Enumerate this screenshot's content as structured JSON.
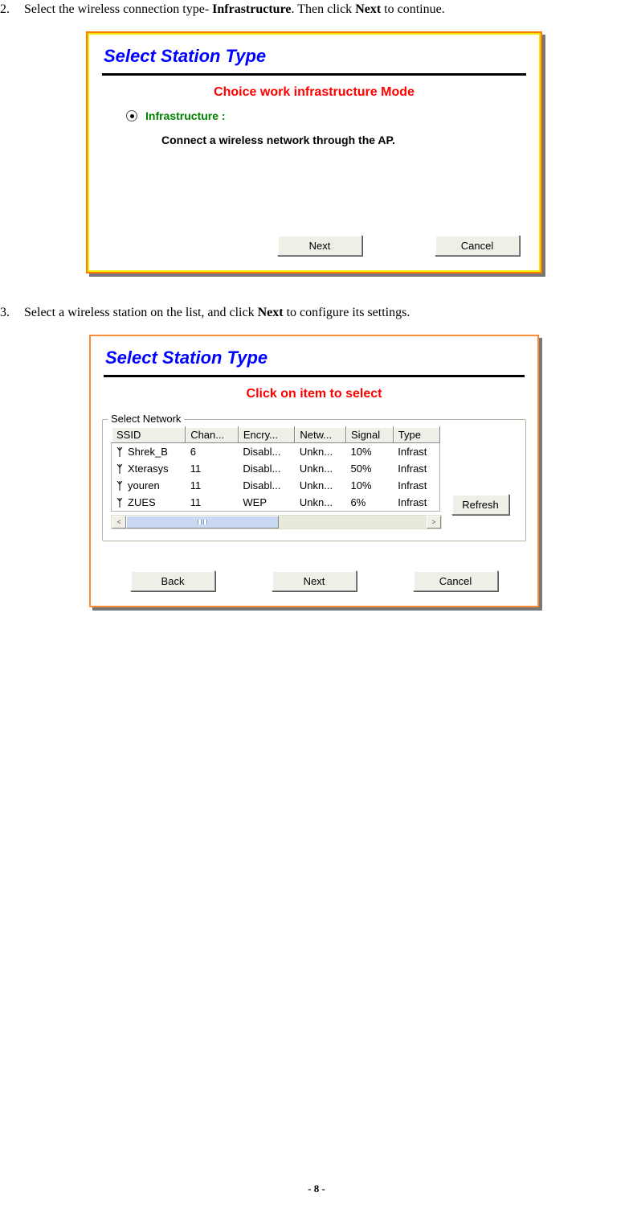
{
  "step2": {
    "num": "2.",
    "text_a": "Select the wireless connection type- ",
    "bold1": "Infrastructure",
    "text_b": ". Then click ",
    "bold2": "Next",
    "text_c": " to continue."
  },
  "win1": {
    "title": "Select Station Type",
    "subtitle": "Choice work infrastructure  Mode",
    "radio_label": "Infrastructure :",
    "radio_desc": "Connect  a wireless  network  through  the AP.",
    "btn_next": "Next",
    "btn_cancel": "Cancel"
  },
  "step3": {
    "num": "3.",
    "text_a": "Select a wireless station on the list, and click ",
    "bold1": "Next",
    "text_b": " to configure its settings."
  },
  "win2": {
    "title": "Select Station Type",
    "subtitle": "Click on item to select",
    "legend": "Select Network",
    "headers": {
      "ssid": "SSID",
      "chan": "Chan...",
      "encry": "Encry...",
      "netw": "Netw...",
      "signal": "Signal",
      "type": "Type"
    },
    "rows": [
      {
        "ssid": "Shrek_B",
        "chan": "6",
        "encry": "Disabl...",
        "netw": "Unkn...",
        "signal": "10%",
        "type": "Infrast"
      },
      {
        "ssid": "Xterasys",
        "chan": "11",
        "encry": "Disabl...",
        "netw": "Unkn...",
        "signal": "50%",
        "type": "Infrast"
      },
      {
        "ssid": "youren",
        "chan": "11",
        "encry": "Disabl...",
        "netw": "Unkn...",
        "signal": "10%",
        "type": "Infrast"
      },
      {
        "ssid": "ZUES",
        "chan": "11",
        "encry": "WEP",
        "netw": "Unkn...",
        "signal": "6%",
        "type": "Infrast"
      }
    ],
    "btn_refresh": "Refresh",
    "btn_back": "Back",
    "btn_next": "Next",
    "btn_cancel": "Cancel",
    "scroll_left": "<",
    "scroll_right": ">"
  },
  "footer": "- 8 -"
}
